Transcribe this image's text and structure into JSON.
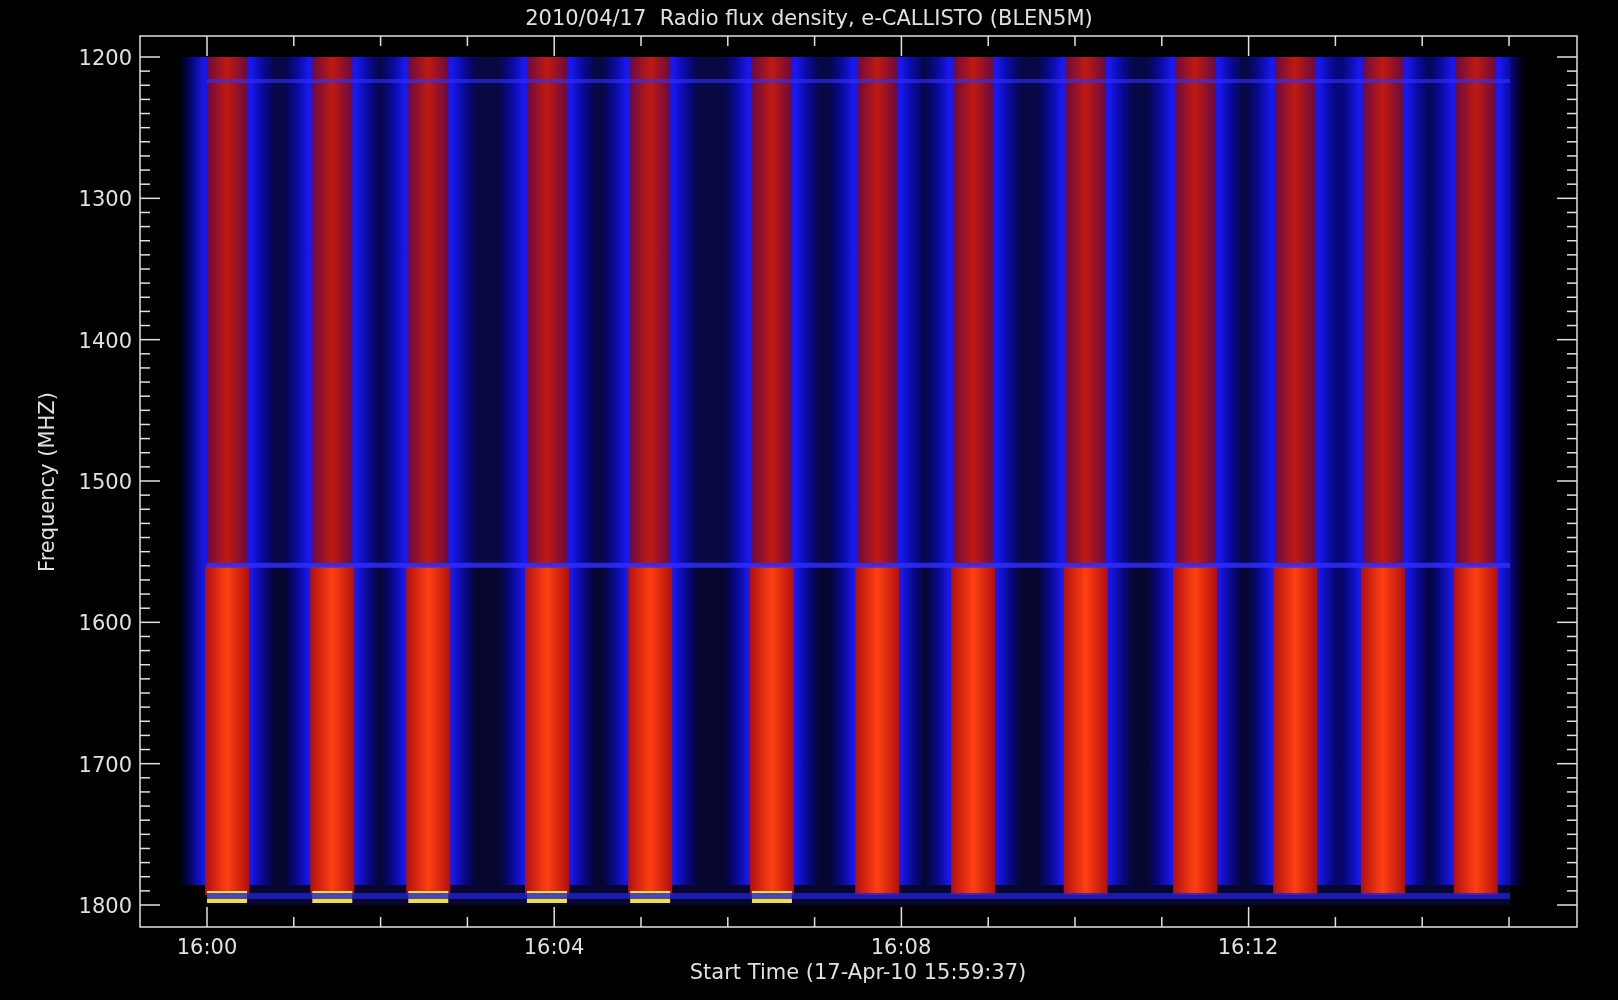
{
  "plot": {
    "title": "2010/04/17  Radio flux density, e-CALLISTO (BLEN5M)",
    "xlabel": "Start Time (17-Apr-10 15:59:37)",
    "ylabel": "Frequency (MHZ)",
    "y_tick_labels": [
      "1200",
      "1300",
      "1400",
      "1500",
      "1600",
      "1700",
      "1800"
    ],
    "x_tick_labels": [
      "16:00",
      "16:04",
      "16:08",
      "16:12"
    ]
  }
}
